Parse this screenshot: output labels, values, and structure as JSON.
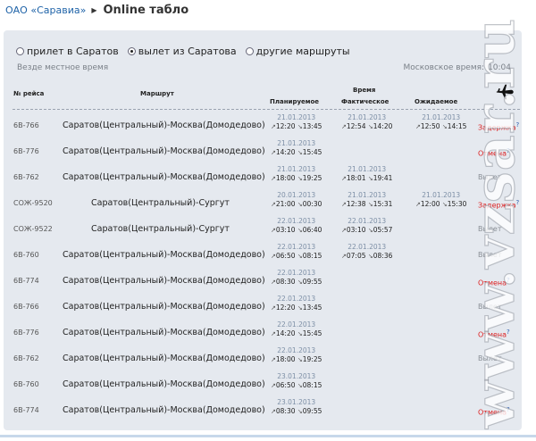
{
  "breadcrumb": {
    "home": "ОАО «Саравиа»",
    "current": "Online табло"
  },
  "filters": {
    "options": [
      "прилет в Саратов",
      "вылет из Саратова",
      "другие маршруты"
    ],
    "selected": 1
  },
  "local_time_note": "Везде местное время",
  "moscow_time": {
    "label": "Московское время:",
    "value": "10:04"
  },
  "table": {
    "headers": {
      "number": "№ рейса",
      "route": "Маршрут",
      "time": "Время",
      "planned": "Планируемое",
      "actual": "Фактическое",
      "expected": "Ожидаемое"
    },
    "rows": [
      {
        "number": "6В-766",
        "route": "Саратов(Центральный)-Москва(Домодедово)",
        "planned": {
          "date": "21.01.2013",
          "dep": "12:20",
          "arr": "13:45"
        },
        "actual": {
          "date": "21.01.2013",
          "dep": "12:54",
          "arr": "14:20"
        },
        "expected": {
          "date": "21.01.2013",
          "dep": "12:50",
          "arr": "14:15"
        },
        "status": "Задержка",
        "status_color": "red",
        "help": "?"
      },
      {
        "number": "6В-776",
        "route": "Саратов(Центральный)-Москва(Домодедово)",
        "planned": {
          "date": "21.01.2013",
          "dep": "14:20",
          "arr": "15:45"
        },
        "status": "Отмена",
        "status_color": "red",
        "help": "?"
      },
      {
        "number": "6В-762",
        "route": "Саратов(Центральный)-Москва(Домодедово)",
        "planned": {
          "date": "21.01.2013",
          "dep": "18:00",
          "arr": "19:25"
        },
        "actual": {
          "date": "21.01.2013",
          "dep": "18:01",
          "arr": "19:41"
        },
        "status": "Вылет",
        "status_color": "grey"
      },
      {
        "number": "СОЖ-9520",
        "route": "Саратов(Центральный)-Сургут",
        "planned": {
          "date": "20.01.2013",
          "dep": "21:00",
          "arr": "00:30"
        },
        "actual": {
          "date": "21.01.2013",
          "dep": "12:38",
          "arr": "15:31"
        },
        "expected": {
          "date": "21.01.2013",
          "dep": "12:00",
          "arr": "15:30"
        },
        "status": "Задержка",
        "status_color": "red",
        "help": "?"
      },
      {
        "number": "СОЖ-9522",
        "route": "Саратов(Центральный)-Сургут",
        "planned": {
          "date": "22.01.2013",
          "dep": "03:10",
          "arr": "06:40"
        },
        "actual": {
          "date": "22.01.2013",
          "dep": "03:10",
          "arr": "05:57"
        },
        "status": "Вылет",
        "status_color": "grey"
      },
      {
        "number": "6В-760",
        "route": "Саратов(Центральный)-Москва(Домодедово)",
        "planned": {
          "date": "22.01.2013",
          "dep": "06:50",
          "arr": "08:15"
        },
        "actual": {
          "date": "22.01.2013",
          "dep": "07:05",
          "arr": "08:36"
        },
        "status": "Вылет",
        "status_color": "grey"
      },
      {
        "number": "6В-774",
        "route": "Саратов(Центральный)-Москва(Домодедово)",
        "planned": {
          "date": "22.01.2013",
          "dep": "08:30",
          "arr": "09:55"
        },
        "status": "Отмена",
        "status_color": "red",
        "help": "?"
      },
      {
        "number": "6В-766",
        "route": "Саратов(Центральный)-Москва(Домодедово)",
        "planned": {
          "date": "22.01.2013",
          "dep": "12:20",
          "arr": "13:45"
        },
        "status": "Вылет",
        "status_color": "grey"
      },
      {
        "number": "6В-776",
        "route": "Саратов(Центральный)-Москва(Домодедово)",
        "planned": {
          "date": "22.01.2013",
          "dep": "14:20",
          "arr": "15:45"
        },
        "status": "Отмена",
        "status_color": "red",
        "help": "?"
      },
      {
        "number": "6В-762",
        "route": "Саратов(Центральный)-Москва(Домодедово)",
        "planned": {
          "date": "22.01.2013",
          "dep": "18:00",
          "arr": "19:25"
        },
        "status": "Вылет",
        "status_color": "grey"
      },
      {
        "number": "6В-760",
        "route": "Саратов(Центральный)-Москва(Домодедово)",
        "planned": {
          "date": "23.01.2013",
          "dep": "06:50",
          "arr": "08:15"
        }
      },
      {
        "number": "6В-774",
        "route": "Саратов(Центральный)-Москва(Домодедово)",
        "planned": {
          "date": "23.01.2013",
          "dep": "08:30",
          "arr": "09:55"
        },
        "status": "Отмена",
        "status_color": "red",
        "help": "?"
      }
    ]
  },
  "icons": {
    "plane": "airplane-icon",
    "departure": "arrow-up-right-icon",
    "arrival": "arrow-down-right-icon"
  },
  "colors": {
    "link": "#1f63a8",
    "panel": "#e5e9ef",
    "delay": "#dd1f1f",
    "cancel": "#dd1f1f",
    "departed": "#8a8f96"
  },
  "watermark": "www.vzsar.ru"
}
